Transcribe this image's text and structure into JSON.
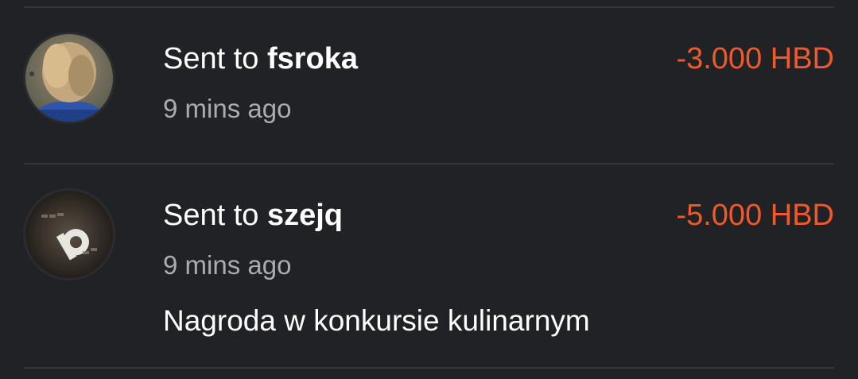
{
  "colors": {
    "background": "#202226",
    "divider": "#34373c",
    "amount_negative": "#f0592b",
    "primary_text": "#ffffff",
    "secondary_text": "#a9acb1"
  },
  "transactions": [
    {
      "prefix": "Sent to ",
      "user": "fsroka",
      "time": "9 mins ago",
      "amount": "-3.000 HBD",
      "avatar_icon": "user-photo-avatar"
    },
    {
      "prefix": "Sent to ",
      "user": "szejq",
      "time": "9 mins ago",
      "amount": "-5.000 HBD",
      "memo": "Nagroda w konkursie kulinarnym",
      "avatar_icon": "user-logo-avatar"
    }
  ]
}
